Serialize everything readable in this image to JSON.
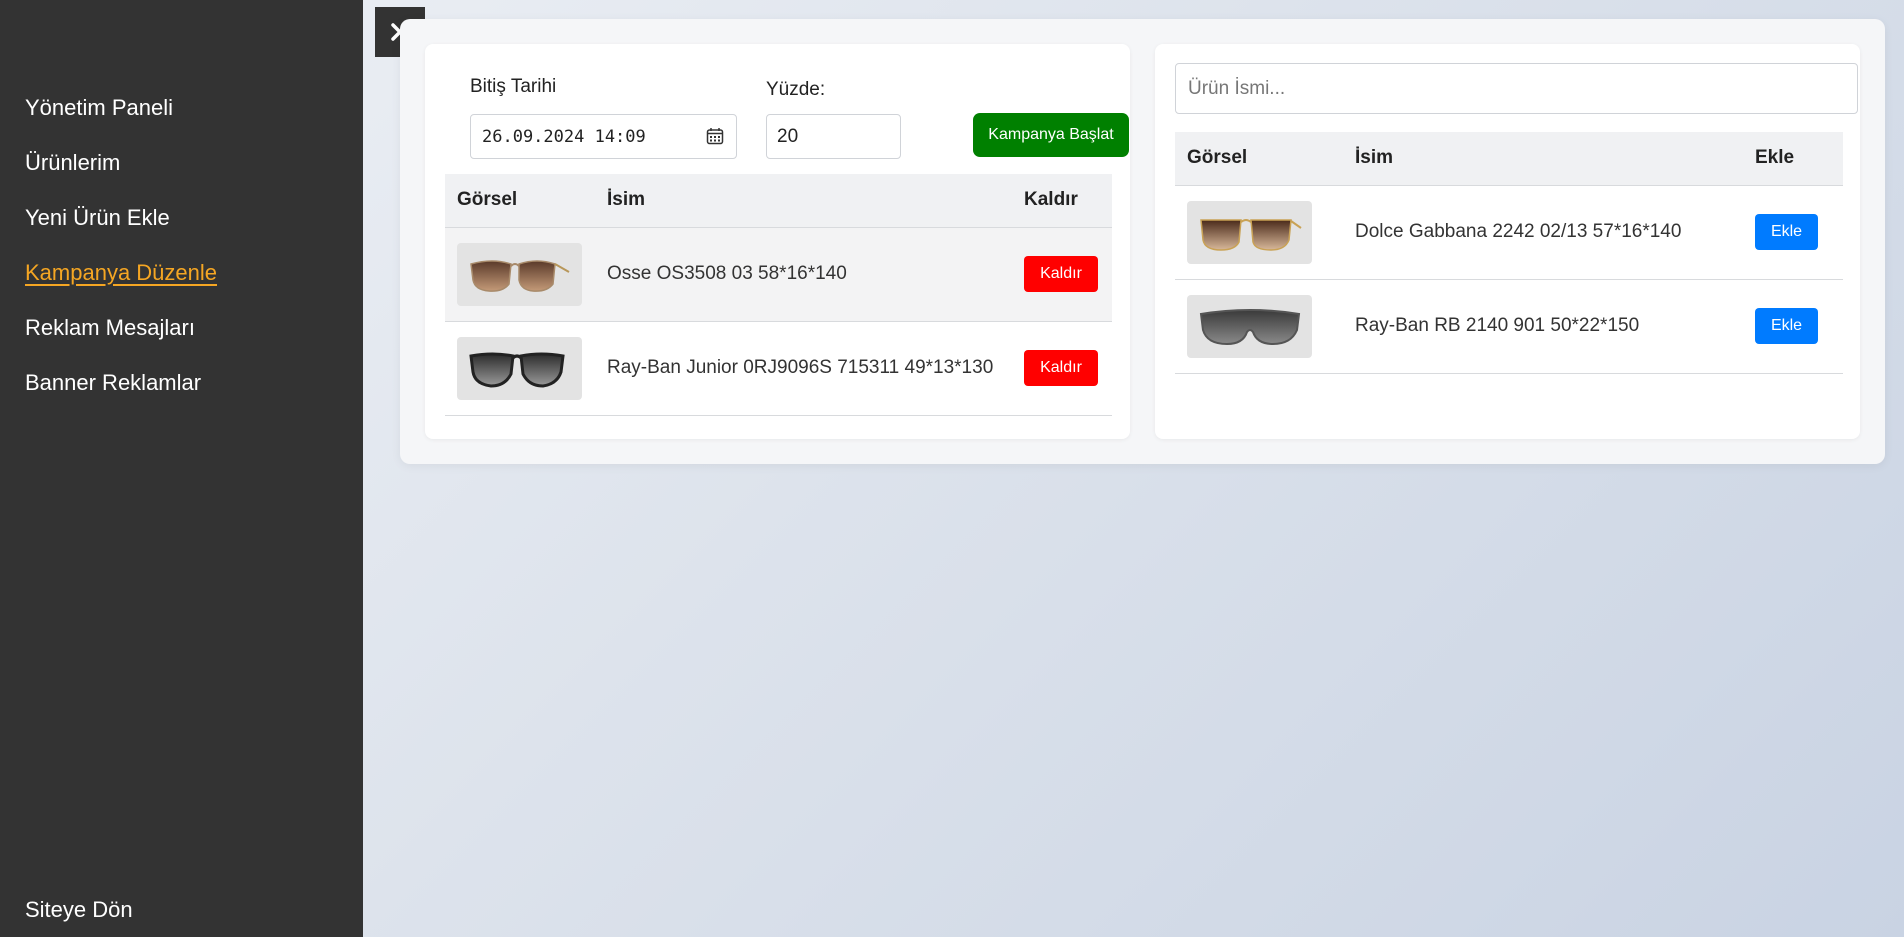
{
  "sidebar": {
    "items": [
      {
        "label": "Yönetim Paneli"
      },
      {
        "label": "Ürünlerim"
      },
      {
        "label": "Yeni Ürün Ekle"
      },
      {
        "label": "Kampanya Düzenle"
      },
      {
        "label": "Reklam Mesajları"
      },
      {
        "label": "Banner Reklamlar"
      }
    ],
    "active_color": "#f5a623",
    "back_label": "Siteye Dön"
  },
  "campaign": {
    "date_label": "Bitiş Tarihi",
    "date_value": "26.09.2024 14:09",
    "percent_label": "Yüzde:",
    "percent_value": "20",
    "start_button": "Kampanya Başlat",
    "headers": {
      "image": "Görsel",
      "name": "İsim",
      "action": "Kaldır"
    },
    "rows": [
      {
        "name": "Osse OS3508 03 58*16*140",
        "action": "Kaldır",
        "glasses_style": "brown-square"
      },
      {
        "name": "Ray-Ban Junior 0RJ9096S 715311 49*13*130",
        "action": "Kaldır",
        "glasses_style": "dark-aviator"
      }
    ]
  },
  "products": {
    "search_placeholder": "Ürün İsmi...",
    "headers": {
      "image": "Görsel",
      "name": "İsim",
      "action": "Ekle"
    },
    "rows": [
      {
        "name": "Dolce Gabbana 2242 02/13 57*16*140",
        "action": "Ekle",
        "glasses_style": "brown-gold"
      },
      {
        "name": "Ray-Ban RB 2140 901 50*22*150",
        "action": "Ekle",
        "glasses_style": "grey-shield"
      }
    ]
  },
  "colors": {
    "remove": "#ff0000",
    "add": "#007bff",
    "start": "#008000",
    "sidebar": "#333333"
  }
}
